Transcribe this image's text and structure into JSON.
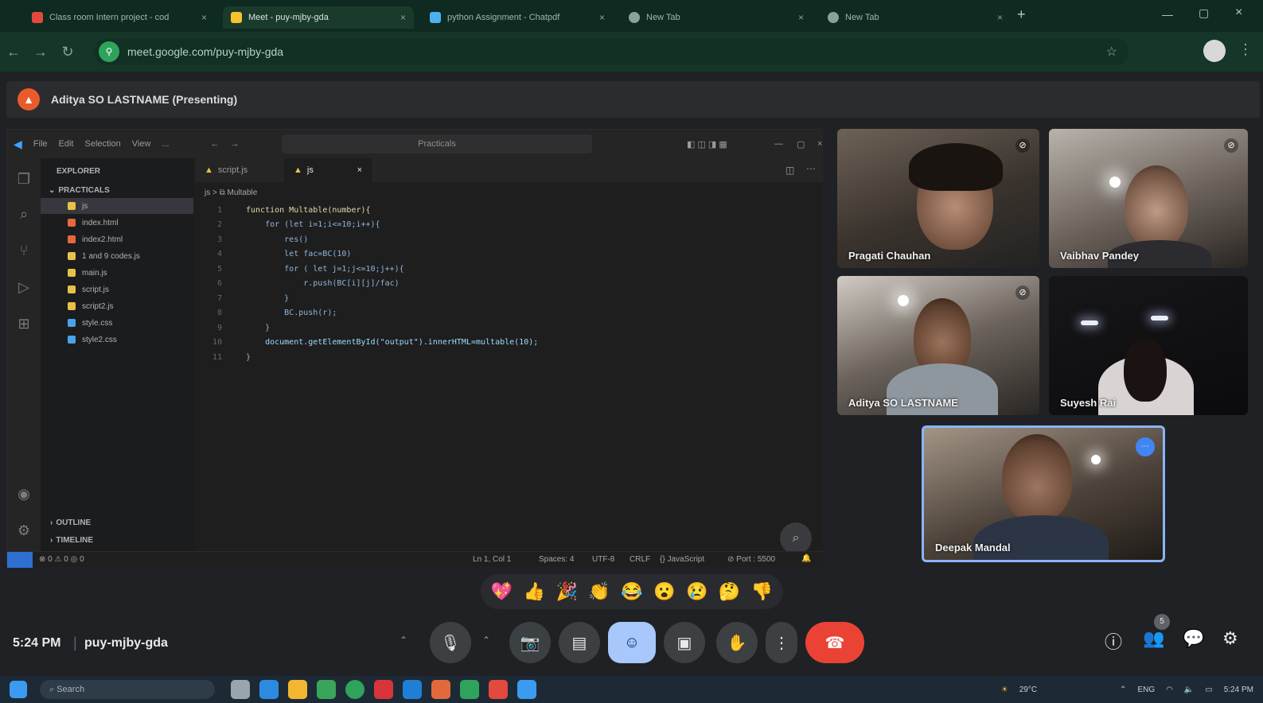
{
  "browser": {
    "tabs": [
      {
        "label": "Class room Intern project - cod",
        "icon_color": "#e3493d"
      },
      {
        "label": "Meet - puy-mjby-gda",
        "icon_color": "#f4c430",
        "active": true
      },
      {
        "label": "python Assignment - Chatpdf",
        "icon_color": "#4db1ef"
      },
      {
        "label": "New Tab",
        "icon_color": "#8aa296"
      },
      {
        "label": "New Tab",
        "icon_color": "#8aa296"
      }
    ],
    "new_tab": "+",
    "url": "meet.google.com/puy-mjby-gda"
  },
  "meet": {
    "presenter_label": "Aditya SO LASTNAME (Presenting)",
    "meeting_code": "puy-mjby-gda",
    "time": "5:24 PM",
    "participants": [
      {
        "name": "Pragati Chauhan"
      },
      {
        "name": "Vaibhav Pandey"
      },
      {
        "name": "Aditya SO LASTNAME"
      },
      {
        "name": "Suyesh Rai"
      },
      {
        "name": "Deepak Mandal"
      }
    ],
    "reactions": [
      "💖",
      "👍",
      "🎉",
      "👏",
      "😂",
      "😮",
      "😢",
      "🤔",
      "👎"
    ],
    "controls": {
      "mic": "🎙",
      "camera": "📷",
      "captions": "▤",
      "emoji": "☺",
      "present": "▣",
      "hand": "✋",
      "more": "⋮",
      "leave": "☎"
    },
    "right_icons": [
      "ⓘ",
      "👥",
      "💬",
      "⚙"
    ],
    "participant_count": "5"
  },
  "vscode": {
    "menu": [
      "File",
      "Edit",
      "Selection",
      "View",
      "..."
    ],
    "search_placeholder": "Practicals",
    "explorer_title": "EXPLORER",
    "folder": "PRACTICALS",
    "files": [
      {
        "name": "js",
        "color": "#e8c14a"
      },
      {
        "name": "index.html",
        "color": "#e3693d"
      },
      {
        "name": "index2.html",
        "color": "#e3693d"
      },
      {
        "name": "1 and 9 codes.js",
        "color": "#e8c14a"
      },
      {
        "name": "main.js",
        "color": "#e8c14a"
      },
      {
        "name": "script.js",
        "color": "#e8c14a"
      },
      {
        "name": "script2.js",
        "color": "#e8c14a"
      },
      {
        "name": "style.css",
        "color": "#4aa3e8"
      },
      {
        "name": "style2.css",
        "color": "#4aa3e8"
      }
    ],
    "sections": [
      "OUTLINE",
      "TIMELINE"
    ],
    "editor_tabs": [
      {
        "label": "script.js"
      },
      {
        "label": "js",
        "active": true,
        "close": "×"
      }
    ],
    "breadcrumb": "js > ⧉ Multable",
    "code": [
      {
        "n": "1",
        "text": "function Multable(number){"
      },
      {
        "n": "2",
        "text": "    for (let i=1;i<=10;i++){"
      },
      {
        "n": "3",
        "text": "        res()"
      },
      {
        "n": "4",
        "text": "        let fac=BC(10)"
      },
      {
        "n": "5",
        "text": "        for ( let j=1;j<=10;j++){"
      },
      {
        "n": "6",
        "text": "            r.push(BC[i][j]/fac)"
      },
      {
        "n": "7",
        "text": "        }"
      },
      {
        "n": "8",
        "text": "        BC.push(r);"
      },
      {
        "n": "9",
        "text": "    }"
      },
      {
        "n": "10",
        "text": "    document.getElementById(\"output\").innerHTML=multable(10);"
      },
      {
        "n": "11",
        "text": "}"
      }
    ],
    "status": {
      "left": "⊗ 0 ⚠ 0  ◎ 0",
      "position": "Ln 1, Col 1",
      "spaces": "Spaces: 4",
      "encoding": "UTF-8",
      "eol": "CRLF",
      "language": "{} JavaScript",
      "port": "⊘ Port : 5500"
    }
  },
  "taskbar": {
    "search": "Search",
    "weather": "29°C",
    "lang": "ENG",
    "clock": "5:24 PM"
  },
  "colors": {
    "leave": "#ea4335",
    "emoji_active": "#a8c7fa",
    "tile_border": "#8ab4f8"
  }
}
